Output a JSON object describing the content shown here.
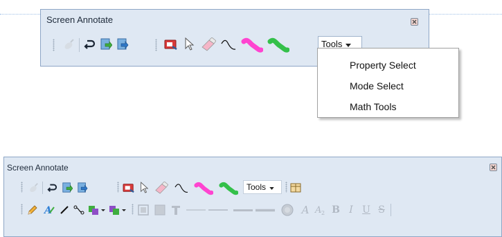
{
  "window_top": {
    "title": "Screen Annotate",
    "tools_label": "Tools",
    "menu_items": [
      {
        "label": "Property Select"
      },
      {
        "label": "Mode Select"
      },
      {
        "label": "Math Tools"
      }
    ]
  },
  "window_bottom": {
    "title": "Screen Annotate",
    "tools_label": "Tools"
  },
  "icons": {
    "tool_icons": [
      "stylus-icon",
      "undo-icon",
      "export-icon",
      "import-icon",
      "screen-capture-icon",
      "arrow-pointer-icon",
      "eraser-icon",
      "pen-stroke-icon",
      "pink-highlighter-icon",
      "green-highlighter-icon"
    ],
    "format_icons": [
      "pencil-icon",
      "text-color-icon",
      "line-icon",
      "connector-icon",
      "fill-color-icon",
      "border-color-icon",
      "frame-icon",
      "fill-box-icon",
      "text-tool-icon",
      "thin-line-icon",
      "thick-line-icon",
      "double-line-icon",
      "circle-icon",
      "italic-a-icon",
      "subscript-icon",
      "bold-icon",
      "italic-icon",
      "underline-icon",
      "strikethrough-icon"
    ]
  },
  "colors": {
    "toolbar_bg": "#dfe8f3",
    "pink": "#ff44d0",
    "green": "#34c04a"
  }
}
